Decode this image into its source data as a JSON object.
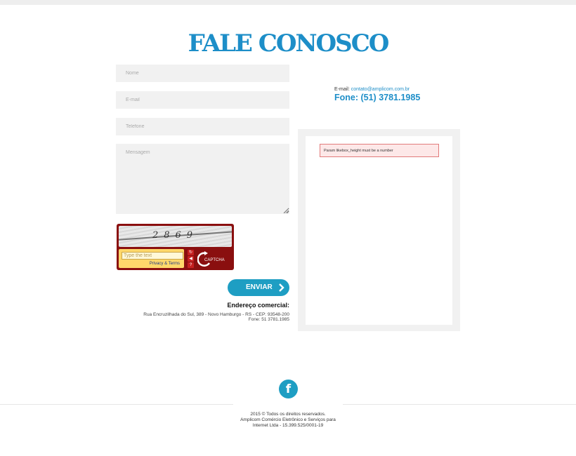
{
  "page": {
    "title": "FALE CONOSCO"
  },
  "form": {
    "name_placeholder": "Nome",
    "email_placeholder": "E-mail",
    "phone_placeholder": "Telefone",
    "message_placeholder": "Mensagem",
    "send_label": "ENVIAR"
  },
  "captcha": {
    "code": "2869",
    "input_placeholder": "Type the text",
    "privacy_link": "Privacy & Terms",
    "logo_text": "CAPTCHA",
    "refresh_icon": "refresh-icon",
    "audio_icon": "audio-icon",
    "help_icon": "help-icon"
  },
  "address": {
    "title": "Endereço comercial:",
    "line1": "Rua Encruzilhada do Sul, 389 - Novo Hamburgo - RS - CEP: 93548-200",
    "line2": "Fone: 51 3781.1985"
  },
  "contact": {
    "email_label": "E-mail: ",
    "email": "contato@amplicom.com.br",
    "phone": "Fone: (51) 3781.1985"
  },
  "social_box": {
    "error": "Param likebox_height must be a number"
  },
  "footer": {
    "social_icon": "facebook-icon",
    "line1": "2015 © Todos os direitos reservados.",
    "line2": "Amplicom Comércio Eletrônico e Serviços para",
    "line3": "Internet Ltda - 15.399.525/0001-19"
  },
  "colors": {
    "accent": "#1d8ec8",
    "button": "#1e9ec3",
    "captcha": "#8a0f0f",
    "field_bg": "#f1f1f1"
  }
}
